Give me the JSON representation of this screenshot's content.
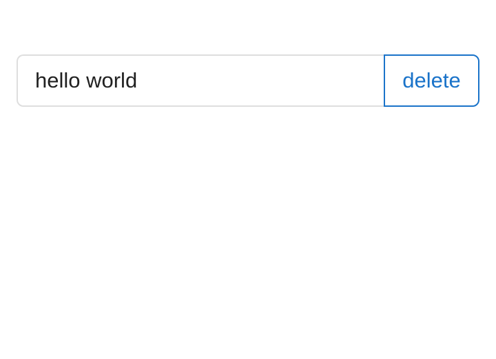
{
  "form": {
    "input_value": "hello world",
    "delete_label": "delete"
  },
  "colors": {
    "accent": "#1a73c9",
    "text": "#212121",
    "input_border": "#dedede",
    "background": "#ffffff"
  }
}
